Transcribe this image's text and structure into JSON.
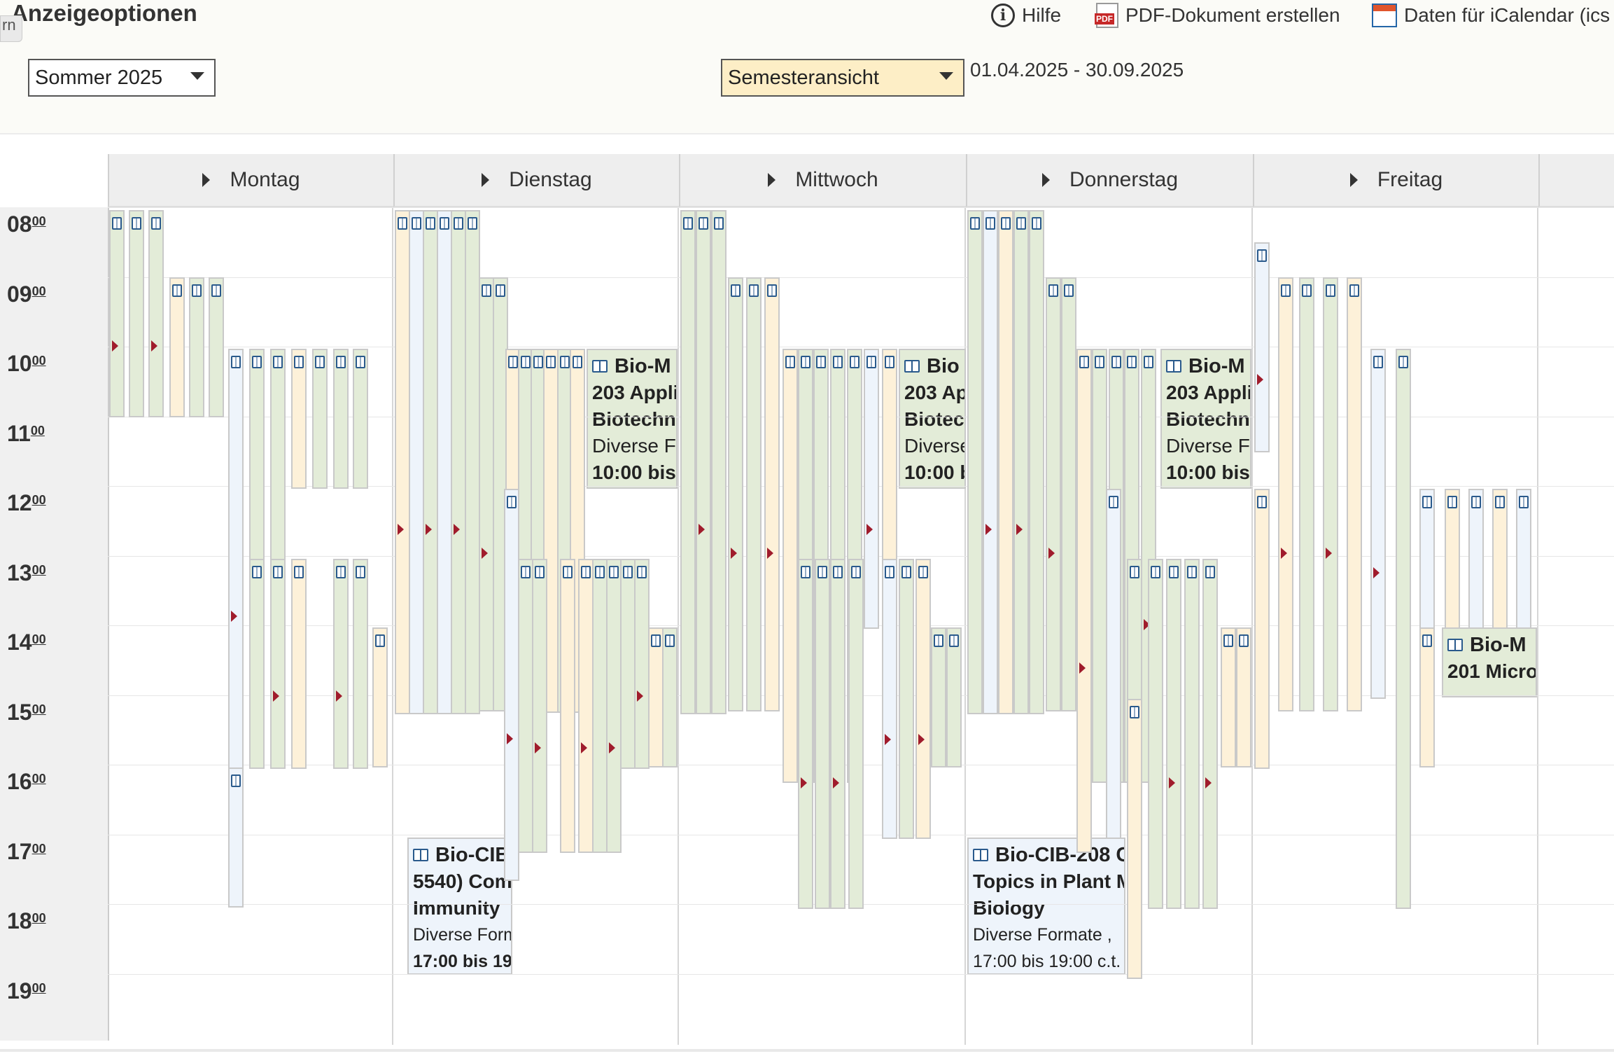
{
  "header": {
    "title": "Anzeigeoptionen",
    "tab_stub": "rn",
    "help_label": "Hilfe",
    "pdf_label": "PDF-Dokument erstellen",
    "ical_label": "Daten für iCalendar (ics"
  },
  "controls": {
    "semester_value": "Sommer 2025",
    "view_value": "Semesteransicht",
    "date_range": "01.04.2025 - 30.09.2025"
  },
  "days": [
    "Montag",
    "Dienstag",
    "Mittwoch",
    "Donnerstag",
    "Freitag"
  ],
  "hours": [
    {
      "h": "08",
      "m": "00"
    },
    {
      "h": "09",
      "m": "00"
    },
    {
      "h": "10",
      "m": "00"
    },
    {
      "h": "11",
      "m": "00"
    },
    {
      "h": "12",
      "m": "00"
    },
    {
      "h": "13",
      "m": "00"
    },
    {
      "h": "14",
      "m": "00"
    },
    {
      "h": "15",
      "m": "00"
    },
    {
      "h": "16",
      "m": "00"
    },
    {
      "h": "17",
      "m": "00"
    },
    {
      "h": "18",
      "m": "00"
    },
    {
      "h": "19",
      "m": "00"
    }
  ],
  "featured_events": {
    "tue_biom": {
      "code": "Bio-M",
      "line1": "203 Appli",
      "line2": "Biotechn",
      "line3": "Diverse Fo",
      "line4": "10:00 bis 1"
    },
    "wed_biom": {
      "code": "Bio",
      "line1": "203 Ap",
      "line2": "Biotec",
      "line3": "Diverse",
      "line4": "10:00 b"
    },
    "thu_biom": {
      "code": "Bio-M",
      "line1": "203 Appli",
      "line2": "Biotechn",
      "line3": "Diverse Fo",
      "line4": "10:00 bis 1"
    },
    "fri_biom": {
      "code": "Bio-M",
      "line1": "201 Micro"
    },
    "tue_cib": {
      "code": "Bio-CIB",
      "line1": "5540) Com",
      "line2": "Immunity",
      "line3": "Diverse Form",
      "line4": "17:00 bis 19"
    },
    "thu_cib": {
      "code": "Bio-CIB-208 C",
      "line1": "Topics in Plant M",
      "line2": "Biology",
      "line3": "Diverse Formate , ",
      "line4": "17:00 bis 19:00 c.t."
    }
  }
}
